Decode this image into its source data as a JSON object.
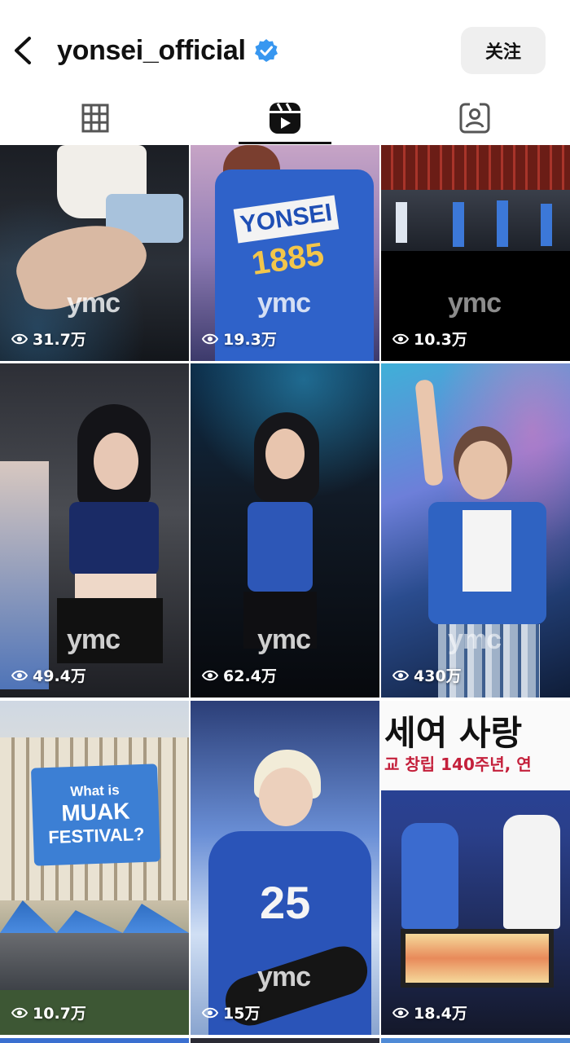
{
  "header": {
    "back_icon": "chevron-left-icon",
    "username": "yonsei_official",
    "verified_icon": "verified-badge-icon",
    "follow_label": "关注"
  },
  "tabs": [
    {
      "icon": "grid-icon",
      "active": false
    },
    {
      "icon": "reels-icon",
      "active": true
    },
    {
      "icon": "tagged-icon",
      "active": false
    }
  ],
  "reels": [
    {
      "views": "31.7万",
      "watermark": "ymc"
    },
    {
      "views": "19.3万",
      "watermark": "ymc"
    },
    {
      "views": "10.3万",
      "watermark": "ymc"
    },
    {
      "views": "49.4万",
      "watermark": "ymc"
    },
    {
      "views": "62.4万",
      "watermark": "ymc"
    },
    {
      "views": "430万",
      "watermark": "ymc"
    },
    {
      "views": "10.7万",
      "banner_lines": [
        "What is",
        "MUAK",
        "FESTIVAL?"
      ]
    },
    {
      "views": "15万",
      "watermark": "ymc"
    },
    {
      "views": "18.4万",
      "sign_text": "세여 사랑",
      "sign_subtext": "교 창립 140주년, 연"
    }
  ],
  "jersey_text": {
    "name": "YONSEI",
    "year": "1885",
    "number": "25"
  },
  "colors": {
    "accent_verified": "#3897f0",
    "yonsei_blue": "#1f4fb5"
  }
}
